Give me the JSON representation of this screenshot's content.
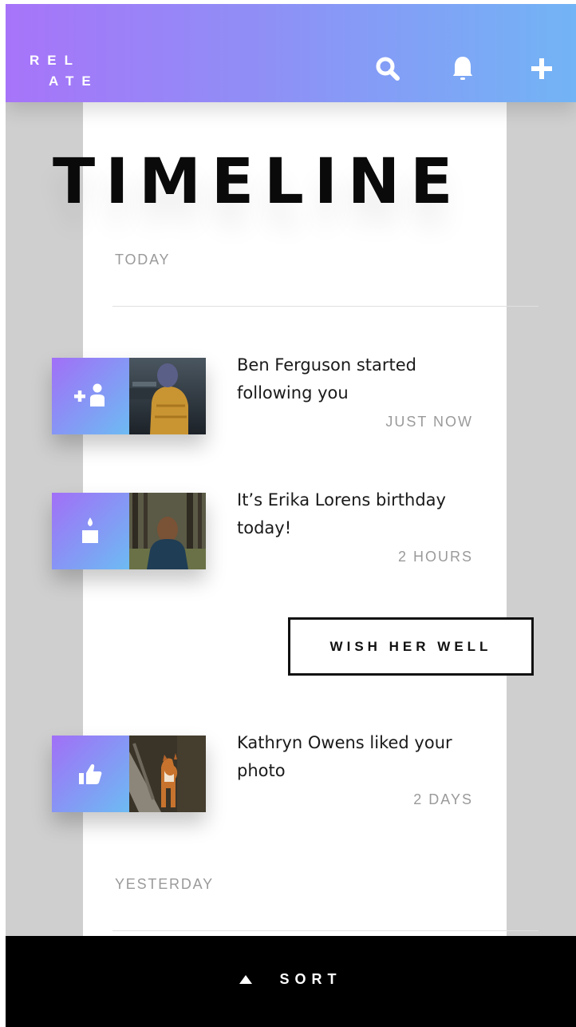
{
  "app": {
    "logo_line1": "REL",
    "logo_line2": "ATE",
    "header_icons": [
      "search-icon",
      "bell-icon",
      "plus-icon"
    ],
    "accent_gradient": [
      "#a774f9",
      "#72b4f5"
    ]
  },
  "page": {
    "title": "TIMELINE"
  },
  "sections": {
    "today": {
      "label": "TODAY",
      "items": [
        {
          "text": "Ben Ferguson started following you",
          "time": "JUST NOW",
          "icon": "add-user-icon"
        },
        {
          "text": "It’s Erika Lorens birthday today!",
          "time": "2 HOURS",
          "icon": "birthday-candle-icon"
        },
        {
          "text": "Kathryn Owens liked your photo",
          "time": "2 DAYS",
          "icon": "thumbs-up-icon"
        }
      ],
      "wish_button": "WISH HER WELL"
    },
    "yesterday": {
      "label": "YESTERDAY"
    }
  },
  "footer": {
    "sort_label": "SORT",
    "sort_icon": "caret-up-icon"
  }
}
